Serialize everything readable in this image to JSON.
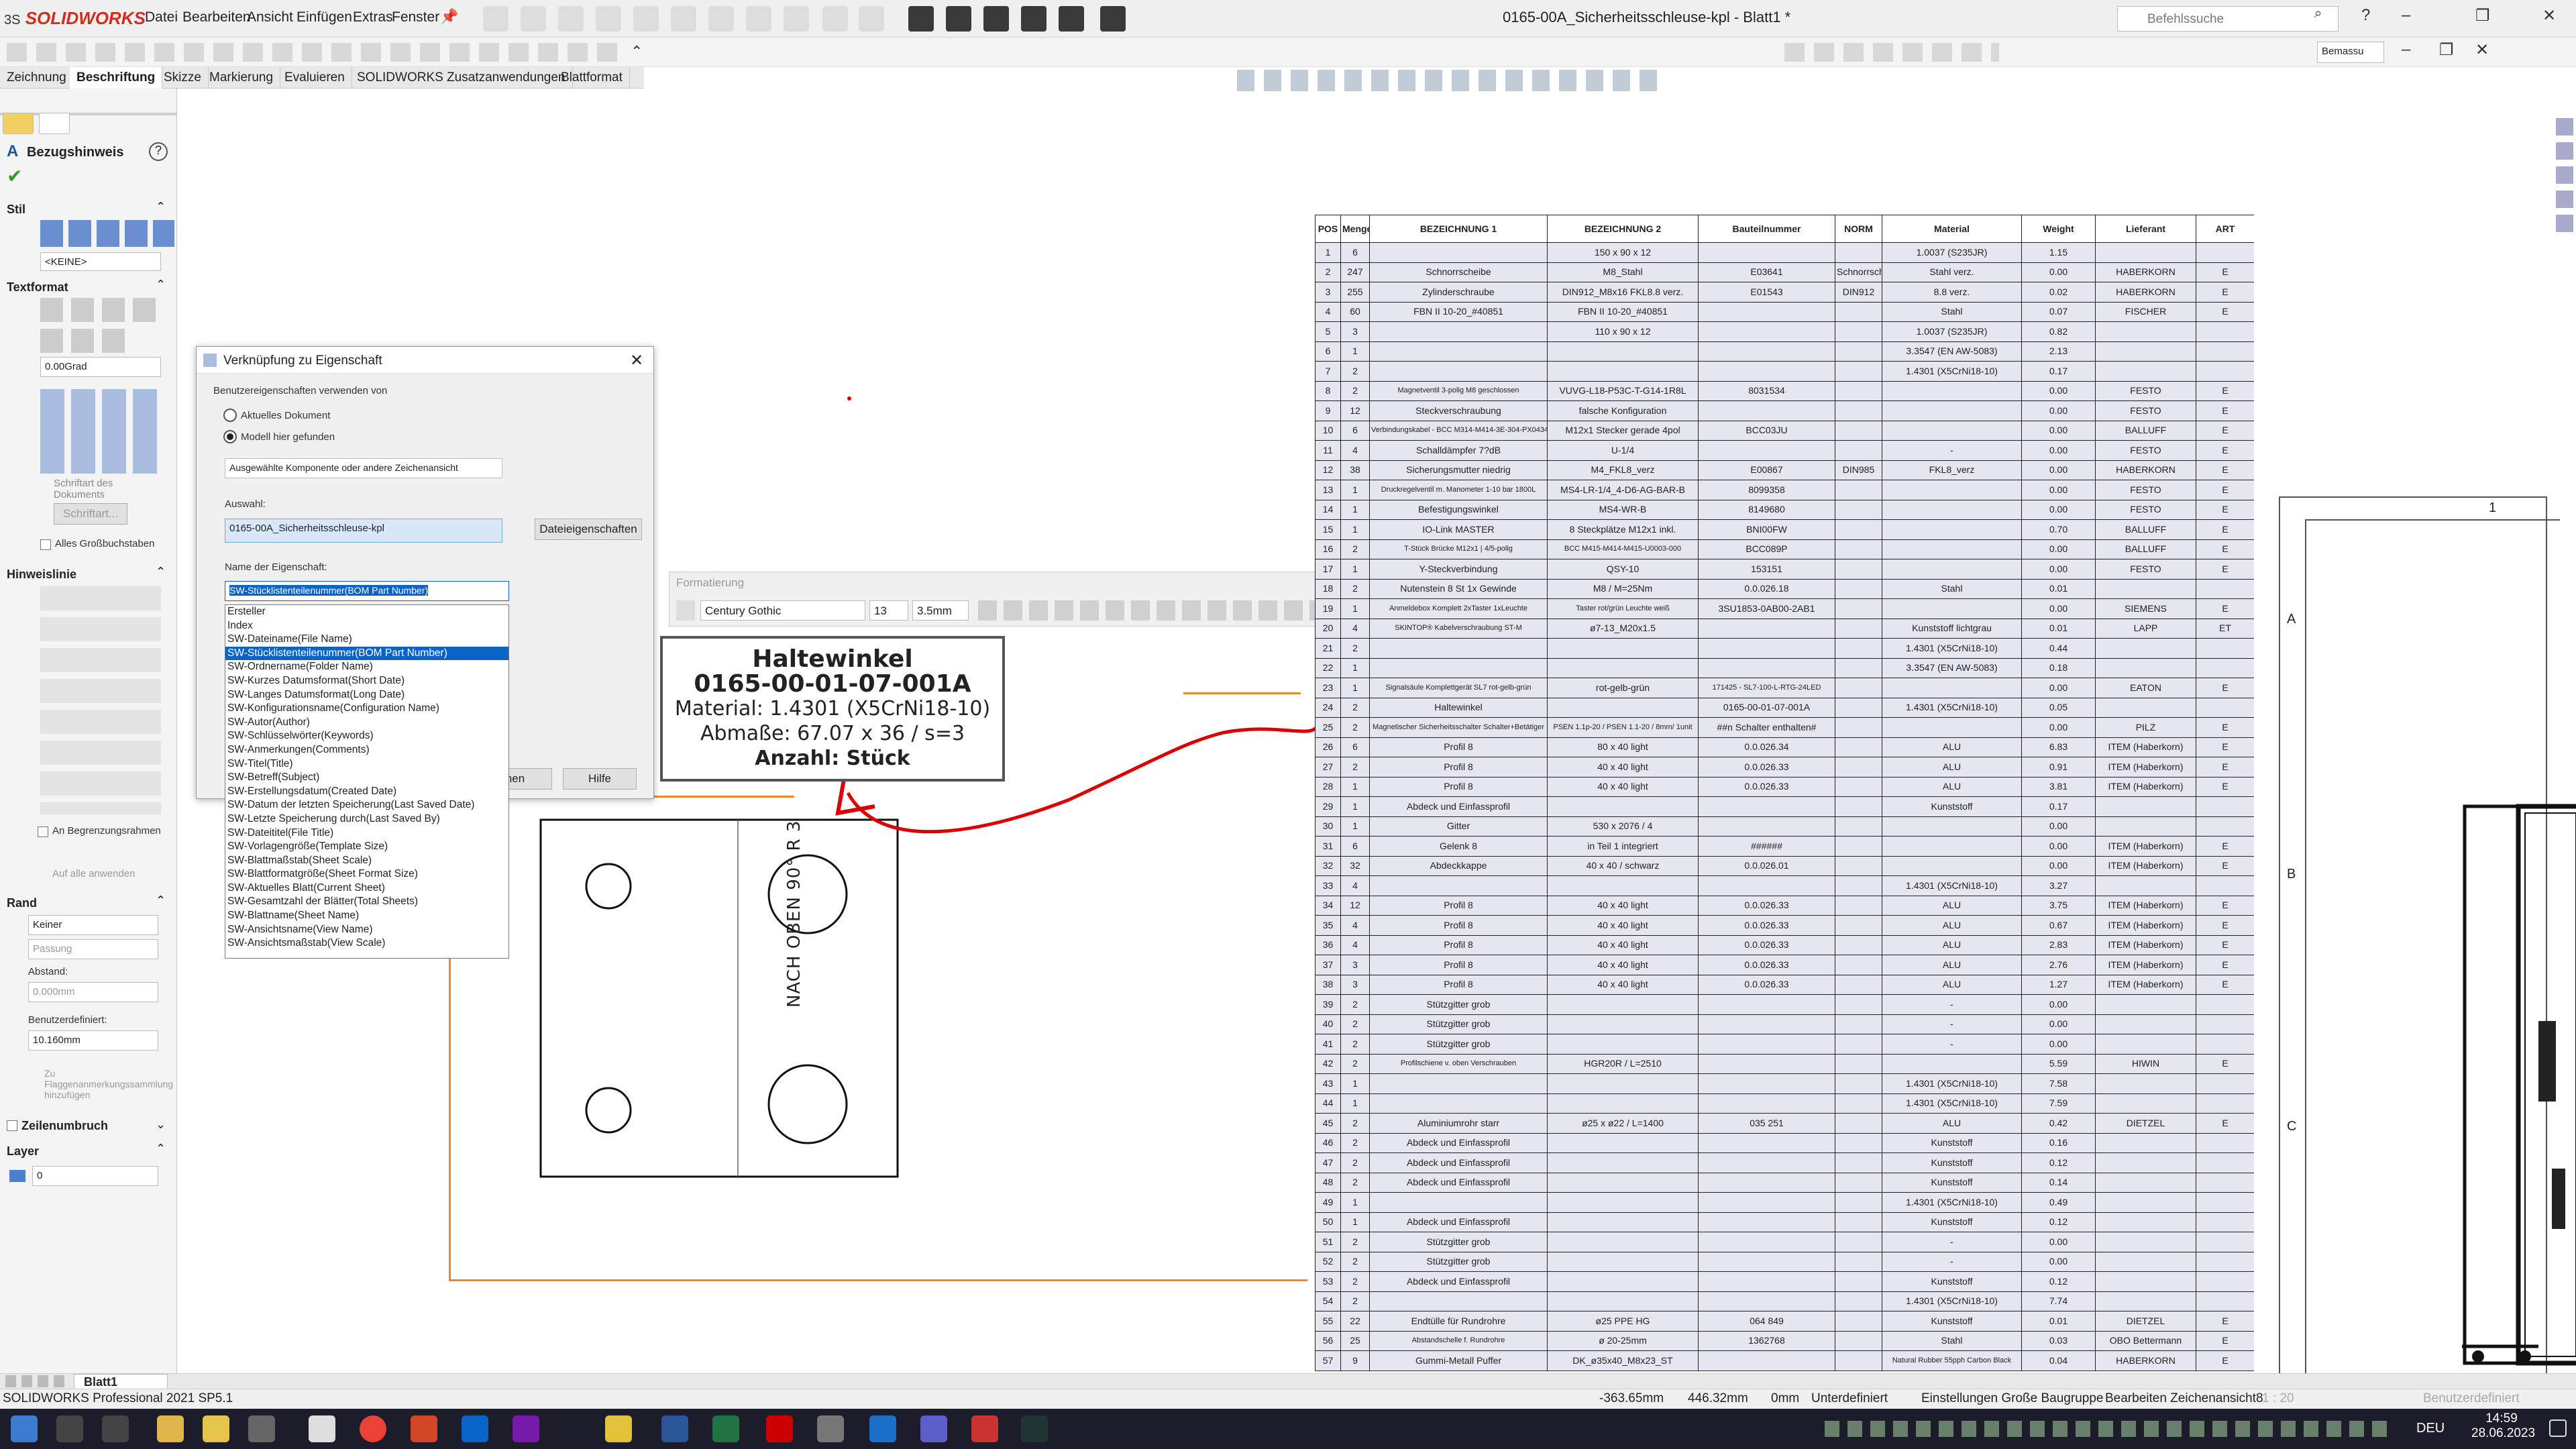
{
  "app": {
    "logo": "SOLIDWORKS",
    "logo_ds": "3S",
    "window_title": "0165-00A_Sicherheitsschleuse-kpl - Blatt1 *",
    "search_placeholder": "Befehlssuche",
    "menu": [
      "Datei",
      "Bearbeiten",
      "Ansicht",
      "Einfügen",
      "Extras",
      "Fenster"
    ],
    "view_select": "Bemassu"
  },
  "tabs": [
    "Zeichnung",
    "Beschriftung",
    "Skizze",
    "Markierung",
    "Evaluieren",
    "SOLIDWORKS Zusatzanwendungen",
    "Blattformat"
  ],
  "panel": {
    "title": "Bezugshinweis",
    "stil": "Stil",
    "keine": "<KEINE>",
    "textformat": "Textformat",
    "angle": "0.00Grad",
    "schriftart_doc": "Schriftart des Dokuments",
    "schriftart_btn": "Schriftart...",
    "alles_gross": "Alles Großbuchstaben",
    "hinweislinie": "Hinweislinie",
    "an_begrenzung": "An Begrenzungsrahmen",
    "auf_alle": "Auf alle anwenden",
    "rand": "Rand",
    "rand_style": "Keiner",
    "rand_fit": "Passung",
    "abstand": "Abstand:",
    "abstand_val": "0.000mm",
    "benutzerdef": "Benutzerdefiniert:",
    "benutzerdef_val": "10.160mm",
    "zu_flag": "Zu Flaggenanmerkungssammlung hinzufügen",
    "zeilenumbruch": "Zeilenumbruch",
    "layer": "Layer",
    "layer_val": "0"
  },
  "dialog": {
    "title": "Verknüpfung zu Eigenschaft",
    "use_from": "Benutzereigenschaften verwenden von",
    "opt1": "Aktuelles Dokument",
    "opt2": "Modell hier gefunden",
    "component": "Ausgewählte Komponente oder andere Zeichenansicht",
    "auswahl_label": "Auswahl:",
    "auswahl_value": "0165-00A_Sicherheitsschleuse-kpl",
    "dateieig": "Dateieigenschaften",
    "name_label": "Name der Eigenschaft:",
    "name_value": "SW-Stücklistenteilenummer(BOM Part Number)",
    "ok_partial": "hen",
    "hilfe": "Hilfe"
  },
  "property_list": [
    "Ersteller",
    "Index",
    "SW-Dateiname(File Name)",
    "SW-Stücklistenteilenummer(BOM Part Number)",
    "SW-Ordnername(Folder Name)",
    "SW-Kurzes Datumsformat(Short Date)",
    "SW-Langes Datumsformat(Long Date)",
    "SW-Konfigurationsname(Configuration Name)",
    "SW-Autor(Author)",
    "SW-Schlüsselwörter(Keywords)",
    "SW-Anmerkungen(Comments)",
    "SW-Titel(Title)",
    "SW-Betreff(Subject)",
    "SW-Erstellungsdatum(Created Date)",
    "SW-Datum der letzten Speicherung(Last Saved Date)",
    "SW-Letzte Speicherung durch(Last Saved By)",
    "SW-Dateititel(File Title)",
    "SW-Vorlagengröße(Template Size)",
    "SW-Blattmaßstab(Sheet Scale)",
    "SW-Blattformatgröße(Sheet Format Size)",
    "SW-Aktuelles Blatt(Current Sheet)",
    "SW-Gesamtzahl der Blätter(Total Sheets)",
    "SW-Blattname(Sheet Name)",
    "SW-Ansichtsname(View Name)",
    "SW-Ansichtsmaßstab(View Scale)"
  ],
  "format_bar": {
    "title": "Formatierung",
    "font": "Century Gothic",
    "size": "13",
    "height": "3.5mm"
  },
  "note": {
    "line1": "Haltewinkel",
    "line2": "0165-00-01-07-001A",
    "line3": "Material: 1.4301 (X5CrNi18-10)",
    "line4": "Abmaße: 67.07  x 36 / s=3",
    "line5": "Anzahl: Stück"
  },
  "drawing": {
    "text": "NACH OBEN 90° R 3"
  },
  "annotation": {
    "mark": "?"
  },
  "bom": {
    "headers": [
      "POS",
      "Menge",
      "BEZEICHNUNG 1",
      "BEZEICHNUNG 2",
      "Bauteilnummer",
      "NORM",
      "Material",
      "Weight",
      "Lieferant",
      "ART"
    ],
    "rows": [
      [
        "1",
        "6",
        "",
        "150 x 90 x 12",
        "",
        "",
        "1.0037 (S235JR)",
        "1.15",
        "",
        ""
      ],
      [
        "2",
        "247",
        "Schnorrscheibe",
        "M8_Stahl",
        "E03641",
        "Schnorrscheibe",
        "Stahl verz.",
        "0.00",
        "HABERKORN",
        "E"
      ],
      [
        "3",
        "255",
        "Zylinderschraube",
        "DIN912_M8x16 FKL8.8 verz.",
        "E01543",
        "DIN912",
        "8.8 verz.",
        "0.02",
        "HABERKORN",
        "E"
      ],
      [
        "4",
        "60",
        "FBN II 10-20_#40851",
        "FBN II 10-20_#40851",
        "",
        "",
        "Stahl",
        "0.07",
        "FISCHER",
        "E"
      ],
      [
        "5",
        "3",
        "",
        "110 x 90 x 12",
        "",
        "",
        "1.0037 (S235JR)",
        "0.82",
        "",
        ""
      ],
      [
        "6",
        "1",
        "",
        "",
        "",
        "",
        "3.3547 (EN AW-5083)",
        "2.13",
        "",
        ""
      ],
      [
        "7",
        "2",
        "",
        "",
        "",
        "",
        "1.4301 (X5CrNi18-10)",
        "0.17",
        "",
        ""
      ],
      [
        "8",
        "2",
        "Magnetventil 3-polig M8 geschlossen",
        "VUVG-L18-P53C-T-G14-1R8L",
        "8031534",
        "",
        "",
        "0.00",
        "FESTO",
        "E"
      ],
      [
        "9",
        "12",
        "Steckverschraubung",
        "falsche Konfiguration",
        "",
        "",
        "",
        "0.00",
        "FESTO",
        "E"
      ],
      [
        "10",
        "6",
        "Verbindungskabel - BCC M314-M414-3E-304-PX0434-030",
        "M12x1 Stecker gerade 4pol",
        "BCC03JU",
        "",
        "",
        "0.00",
        "BALLUFF",
        "E"
      ],
      [
        "11",
        "4",
        "Schalldämpfer 7?dB",
        "U-1/4",
        "",
        "",
        "-",
        "0.00",
        "FESTO",
        "E"
      ],
      [
        "12",
        "38",
        "Sicherungsmutter niedrig",
        "M4_FKL8_verz",
        "E00867",
        "DIN985",
        "FKL8_verz",
        "0.00",
        "HABERKORN",
        "E"
      ],
      [
        "13",
        "1",
        "Druckregelventil m. Manometer 1-10 bar 1800L",
        "MS4-LR-1/4_4-D6-AG-BAR-B",
        "8099358",
        "",
        "",
        "0.00",
        "FESTO",
        "E"
      ],
      [
        "14",
        "1",
        "Befestigungswinkel",
        "MS4-WR-B",
        "8149680",
        "",
        "",
        "0.00",
        "FESTO",
        "E"
      ],
      [
        "15",
        "1",
        "IO-Link MASTER",
        "8 Steckplätze M12x1 inkl.",
        "BNI00FW",
        "",
        "",
        "0.70",
        "BALLUFF",
        "E"
      ],
      [
        "16",
        "2",
        "T-Stück Brücke M12x1 | 4/5-polig",
        "BCC M415-M414-M415-U0003-000",
        "BCC089P",
        "",
        "",
        "0.00",
        "BALLUFF",
        "E"
      ],
      [
        "17",
        "1",
        "Y-Steckverbindung",
        "QSY-10",
        "153151",
        "",
        "",
        "0.00",
        "FESTO",
        "E"
      ],
      [
        "18",
        "2",
        "Nutenstein 8 St 1x Gewinde",
        "M8 / M=25Nm",
        "0.0.026.18",
        "",
        "Stahl",
        "0.01",
        "",
        ""
      ],
      [
        "19",
        "1",
        "Anmeldebox Komplett 2xTaster 1xLeuchte",
        "Taster rot/grün Leuchte weiß",
        "3SU1853-0AB00-2AB1",
        "",
        "",
        "0.00",
        "SIEMENS",
        "E"
      ],
      [
        "20",
        "4",
        "SKINTOP® Kabelverschraubung ST-M",
        "ø7-13_M20x1.5",
        "",
        "",
        "Kunststoff lichtgrau",
        "0.01",
        "LAPP",
        "ET"
      ],
      [
        "21",
        "2",
        "",
        "",
        "",
        "",
        "1.4301 (X5CrNi18-10)",
        "0.44",
        "",
        ""
      ],
      [
        "22",
        "1",
        "",
        "",
        "",
        "",
        "3.3547 (EN AW-5083)",
        "0.18",
        "",
        ""
      ],
      [
        "23",
        "1",
        "Signalsäule Komplettgerät SL7 rot-gelb-grün",
        "rot-gelb-grün",
        "171425 - SL7-100-L-RTG-24LED",
        "",
        "",
        "0.00",
        "EATON",
        "E"
      ],
      [
        "24",
        "2",
        "Haltewinkel",
        "",
        "0165-00-01-07-001A",
        "",
        "1.4301 (X5CrNi18-10)",
        "0.05",
        "",
        ""
      ],
      [
        "25",
        "2",
        "Magnetischer Sicherheitsschalter Schalter+Betätiger",
        "PSEN 1.1p-20 / PSEN 1.1-20 / 8mm/ 1unit",
        "##n Schalter enthalten#",
        "",
        "",
        "0.00",
        "PILZ",
        "E"
      ],
      [
        "26",
        "6",
        "Profil 8",
        "80 x 40 light",
        "0.0.026.34",
        "",
        "ALU",
        "6.83",
        "ITEM (Haberkorn)",
        "E"
      ],
      [
        "27",
        "2",
        "Profil 8",
        "40 x 40 light",
        "0.0.026.33",
        "",
        "ALU",
        "0.91",
        "ITEM (Haberkorn)",
        "E"
      ],
      [
        "28",
        "1",
        "Profil 8",
        "40 x 40 light",
        "0.0.026.33",
        "",
        "ALU",
        "3.81",
        "ITEM (Haberkorn)",
        "E"
      ],
      [
        "29",
        "1",
        "Abdeck und Einfassprofil",
        "",
        "",
        "",
        "Kunststoff",
        "0.17",
        "",
        ""
      ],
      [
        "30",
        "1",
        "Gitter",
        "530 x 2076 / 4",
        "",
        "",
        "",
        "0.00",
        "",
        ""
      ],
      [
        "31",
        "6",
        "Gelenk 8",
        "in Teil 1 integriert",
        "######",
        "",
        "",
        "0.00",
        "ITEM (Haberkorn)",
        "E"
      ],
      [
        "32",
        "32",
        "Abdeckkappe",
        "40 x 40 / schwarz",
        "0.0.026.01",
        "",
        "",
        "0.00",
        "ITEM (Haberkorn)",
        "E"
      ],
      [
        "33",
        "4",
        "",
        "",
        "",
        "",
        "1.4301 (X5CrNi18-10)",
        "3.27",
        "",
        ""
      ],
      [
        "34",
        "12",
        "Profil 8",
        "40 x 40 light",
        "0.0.026.33",
        "",
        "ALU",
        "3.75",
        "ITEM (Haberkorn)",
        "E"
      ],
      [
        "35",
        "4",
        "Profil 8",
        "40 x 40 light",
        "0.0.026.33",
        "",
        "ALU",
        "0.67",
        "ITEM (Haberkorn)",
        "E"
      ],
      [
        "36",
        "4",
        "Profil 8",
        "40 x 40 light",
        "0.0.026.33",
        "",
        "ALU",
        "2.83",
        "ITEM (Haberkorn)",
        "E"
      ],
      [
        "37",
        "3",
        "Profil 8",
        "40 x 40 light",
        "0.0.026.33",
        "",
        "ALU",
        "2.76",
        "ITEM (Haberkorn)",
        "E"
      ],
      [
        "38",
        "3",
        "Profil 8",
        "40 x 40 light",
        "0.0.026.33",
        "",
        "ALU",
        "1.27",
        "ITEM (Haberkorn)",
        "E"
      ],
      [
        "39",
        "2",
        "Stützgitter grob",
        "",
        "",
        "",
        "-",
        "0.00",
        "",
        ""
      ],
      [
        "40",
        "2",
        "Stützgitter grob",
        "",
        "",
        "",
        "-",
        "0.00",
        "",
        ""
      ],
      [
        "41",
        "2",
        "Stützgitter grob",
        "",
        "",
        "",
        "-",
        "0.00",
        "",
        ""
      ],
      [
        "42",
        "2",
        "Profilschiene v. oben Verschrauben",
        "HGR20R / L=2510",
        "",
        "",
        "",
        "5.59",
        "HIWIN",
        "E"
      ],
      [
        "43",
        "1",
        "",
        "",
        "",
        "",
        "1.4301 (X5CrNi18-10)",
        "7.58",
        "",
        ""
      ],
      [
        "44",
        "1",
        "",
        "",
        "",
        "",
        "1.4301 (X5CrNi18-10)",
        "7.59",
        "",
        ""
      ],
      [
        "45",
        "2",
        "Aluminiumrohr starr",
        "ø25 x ø22 / L=1400",
        "035 251",
        "",
        "ALU",
        "0.42",
        "DIETZEL",
        "E"
      ],
      [
        "46",
        "2",
        "Abdeck und Einfassprofil",
        "",
        "",
        "",
        "Kunststoff",
        "0.16",
        "",
        ""
      ],
      [
        "47",
        "2",
        "Abdeck und Einfassprofil",
        "",
        "",
        "",
        "Kunststoff",
        "0.12",
        "",
        ""
      ],
      [
        "48",
        "2",
        "Abdeck und Einfassprofil",
        "",
        "",
        "",
        "Kunststoff",
        "0.14",
        "",
        ""
      ],
      [
        "49",
        "1",
        "",
        "",
        "",
        "",
        "1.4301 (X5CrNi18-10)",
        "0.49",
        "",
        ""
      ],
      [
        "50",
        "1",
        "Abdeck und Einfassprofil",
        "",
        "",
        "",
        "Kunststoff",
        "0.12",
        "",
        ""
      ],
      [
        "51",
        "2",
        "Stützgitter grob",
        "",
        "",
        "",
        "-",
        "0.00",
        "",
        ""
      ],
      [
        "52",
        "2",
        "Stützgitter grob",
        "",
        "",
        "",
        "-",
        "0.00",
        "",
        ""
      ],
      [
        "53",
        "2",
        "Abdeck und Einfassprofil",
        "",
        "",
        "",
        "Kunststoff",
        "0.12",
        "",
        ""
      ],
      [
        "54",
        "2",
        "",
        "",
        "",
        "",
        "1.4301 (X5CrNi18-10)",
        "7.74",
        "",
        ""
      ],
      [
        "55",
        "22",
        "Endtülle für Rundrohre",
        "ø25 PPE HG",
        "064 849",
        "",
        "Kunststoff",
        "0.01",
        "DIETZEL",
        "E"
      ],
      [
        "56",
        "25",
        "Abstandschelle f. Rundrohre",
        "ø 20-25mm",
        "1362768",
        "",
        "Stahl",
        "0.03",
        "OBO Bettermann",
        "E"
      ],
      [
        "57",
        "9",
        "Gummi-Metall Puffer",
        "DK_ø35x40_M8x23_ST",
        "",
        "",
        "Natural Rubber 55pph Carbon Black",
        "0.04",
        "HABERKORN",
        "E"
      ]
    ]
  },
  "frame_labels": {
    "top": "1",
    "rows": [
      "A",
      "B",
      "C"
    ]
  },
  "sheet_tab": "Blatt1",
  "statusbar": {
    "left": "SOLIDWORKS Professional 2021 SP5.1",
    "x": "-363.65mm",
    "y": "446.32mm",
    "z": "0mm",
    "status": "Unterdefiniert",
    "config": "Einstellungen Große Baugruppe",
    "edit": "Bearbeiten Zeichenansicht8",
    "scale": "1 : 20",
    "custom": "Benutzerdefiniert"
  },
  "taskbar": {
    "lang": "DEU",
    "time": "14:59",
    "date": "28.06.2023"
  }
}
